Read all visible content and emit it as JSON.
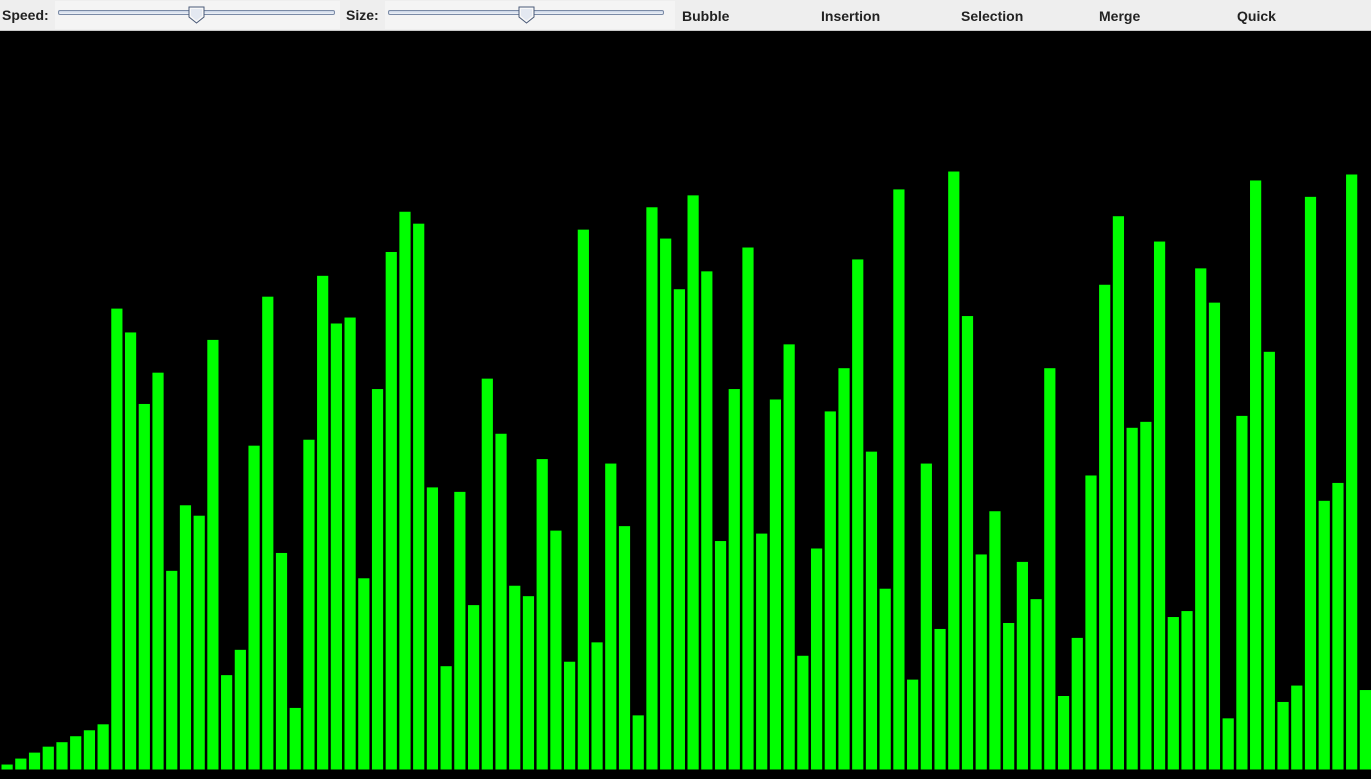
{
  "toolbar": {
    "speed_label": "Speed:",
    "size_label": "Size:",
    "speed_value": 0.5,
    "size_value": 0.5,
    "buttons": [
      "Bubble",
      "Insertion",
      "Selection",
      "Merge",
      "Quick"
    ]
  },
  "colors": {
    "bar": "#00ff00",
    "background": "#000000",
    "toolbar": "#eeeeee"
  },
  "chart_data": {
    "type": "bar",
    "ylim": [
      0,
      400
    ],
    "values": [
      4,
      8,
      12,
      16,
      19,
      23,
      27,
      31,
      310,
      294,
      246,
      267,
      134,
      178,
      171,
      289,
      64,
      81,
      218,
      318,
      146,
      42,
      222,
      332,
      300,
      304,
      129,
      256,
      348,
      375,
      367,
      190,
      70,
      187,
      111,
      263,
      226,
      124,
      117,
      209,
      161,
      73,
      363,
      86,
      206,
      164,
      37,
      378,
      357,
      323,
      386,
      335,
      154,
      256,
      351,
      159,
      249,
      286,
      77,
      149,
      241,
      270,
      343,
      214,
      122,
      390,
      61,
      206,
      95,
      402,
      305,
      145,
      174,
      99,
      140,
      115,
      270,
      50,
      89,
      198,
      326,
      372,
      230,
      234,
      355,
      103,
      107,
      337,
      314,
      35,
      238,
      396,
      281,
      46,
      57,
      385,
      181,
      193,
      400,
      54
    ]
  }
}
